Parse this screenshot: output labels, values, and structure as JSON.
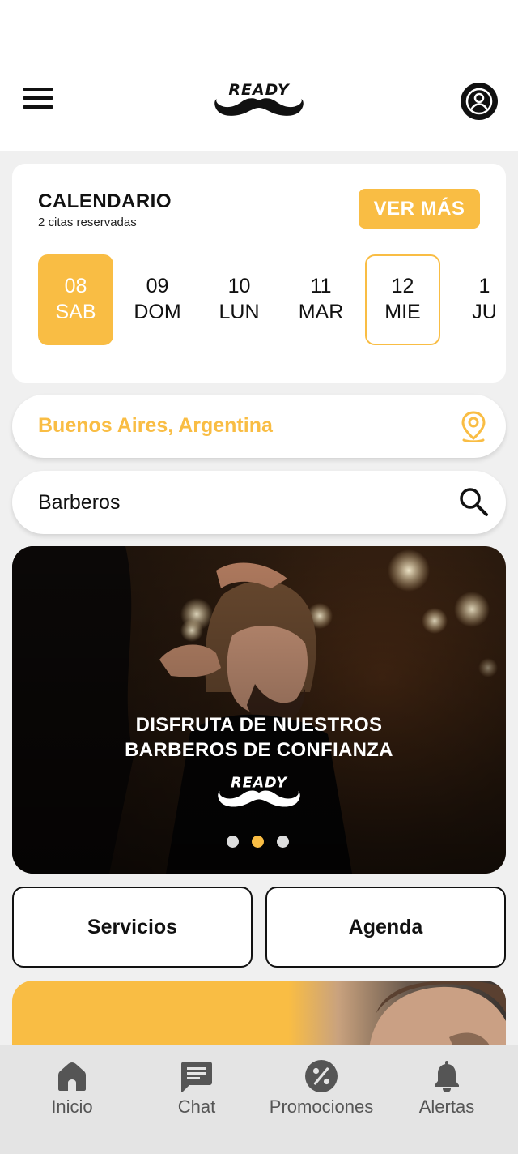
{
  "header": {
    "logo_text": "READY",
    "menu_icon": "hamburger-menu-icon",
    "profile_icon": "user-circle-icon"
  },
  "calendar": {
    "title": "CALENDARIO",
    "subtitle": "2 citas reservadas",
    "more_label": "VER MÁS",
    "days": [
      {
        "num": "08",
        "day": "SAB",
        "state": "selected"
      },
      {
        "num": "09",
        "day": "DOM",
        "state": "normal"
      },
      {
        "num": "10",
        "day": "LUN",
        "state": "normal"
      },
      {
        "num": "11",
        "day": "MAR",
        "state": "normal"
      },
      {
        "num": "12",
        "day": "MIE",
        "state": "outlined"
      },
      {
        "num": "1",
        "day": "JU",
        "state": "partial"
      }
    ]
  },
  "location": {
    "value": "Buenos Aires, Argentina",
    "icon": "map-pin-icon"
  },
  "search": {
    "placeholder": "Barberos",
    "icon": "search-icon"
  },
  "banner": {
    "line1": "DISFRUTA DE NUESTROS",
    "line2": "BARBEROS DE CONFIANZA",
    "logo_text": "READY",
    "slides": 3,
    "active_slide": 2
  },
  "actions": {
    "services_label": "Servicios",
    "agenda_label": "Agenda"
  },
  "nav": {
    "items": [
      {
        "label": "Inicio",
        "icon": "home-icon"
      },
      {
        "label": "Chat",
        "icon": "chat-icon"
      },
      {
        "label": "Promociones",
        "icon": "percent-icon"
      },
      {
        "label": "Alertas",
        "icon": "bell-icon"
      }
    ]
  },
  "colors": {
    "accent": "#f9bd44",
    "text": "#111111",
    "nav_bg": "#e4e4e4",
    "nav_text": "#555555"
  }
}
